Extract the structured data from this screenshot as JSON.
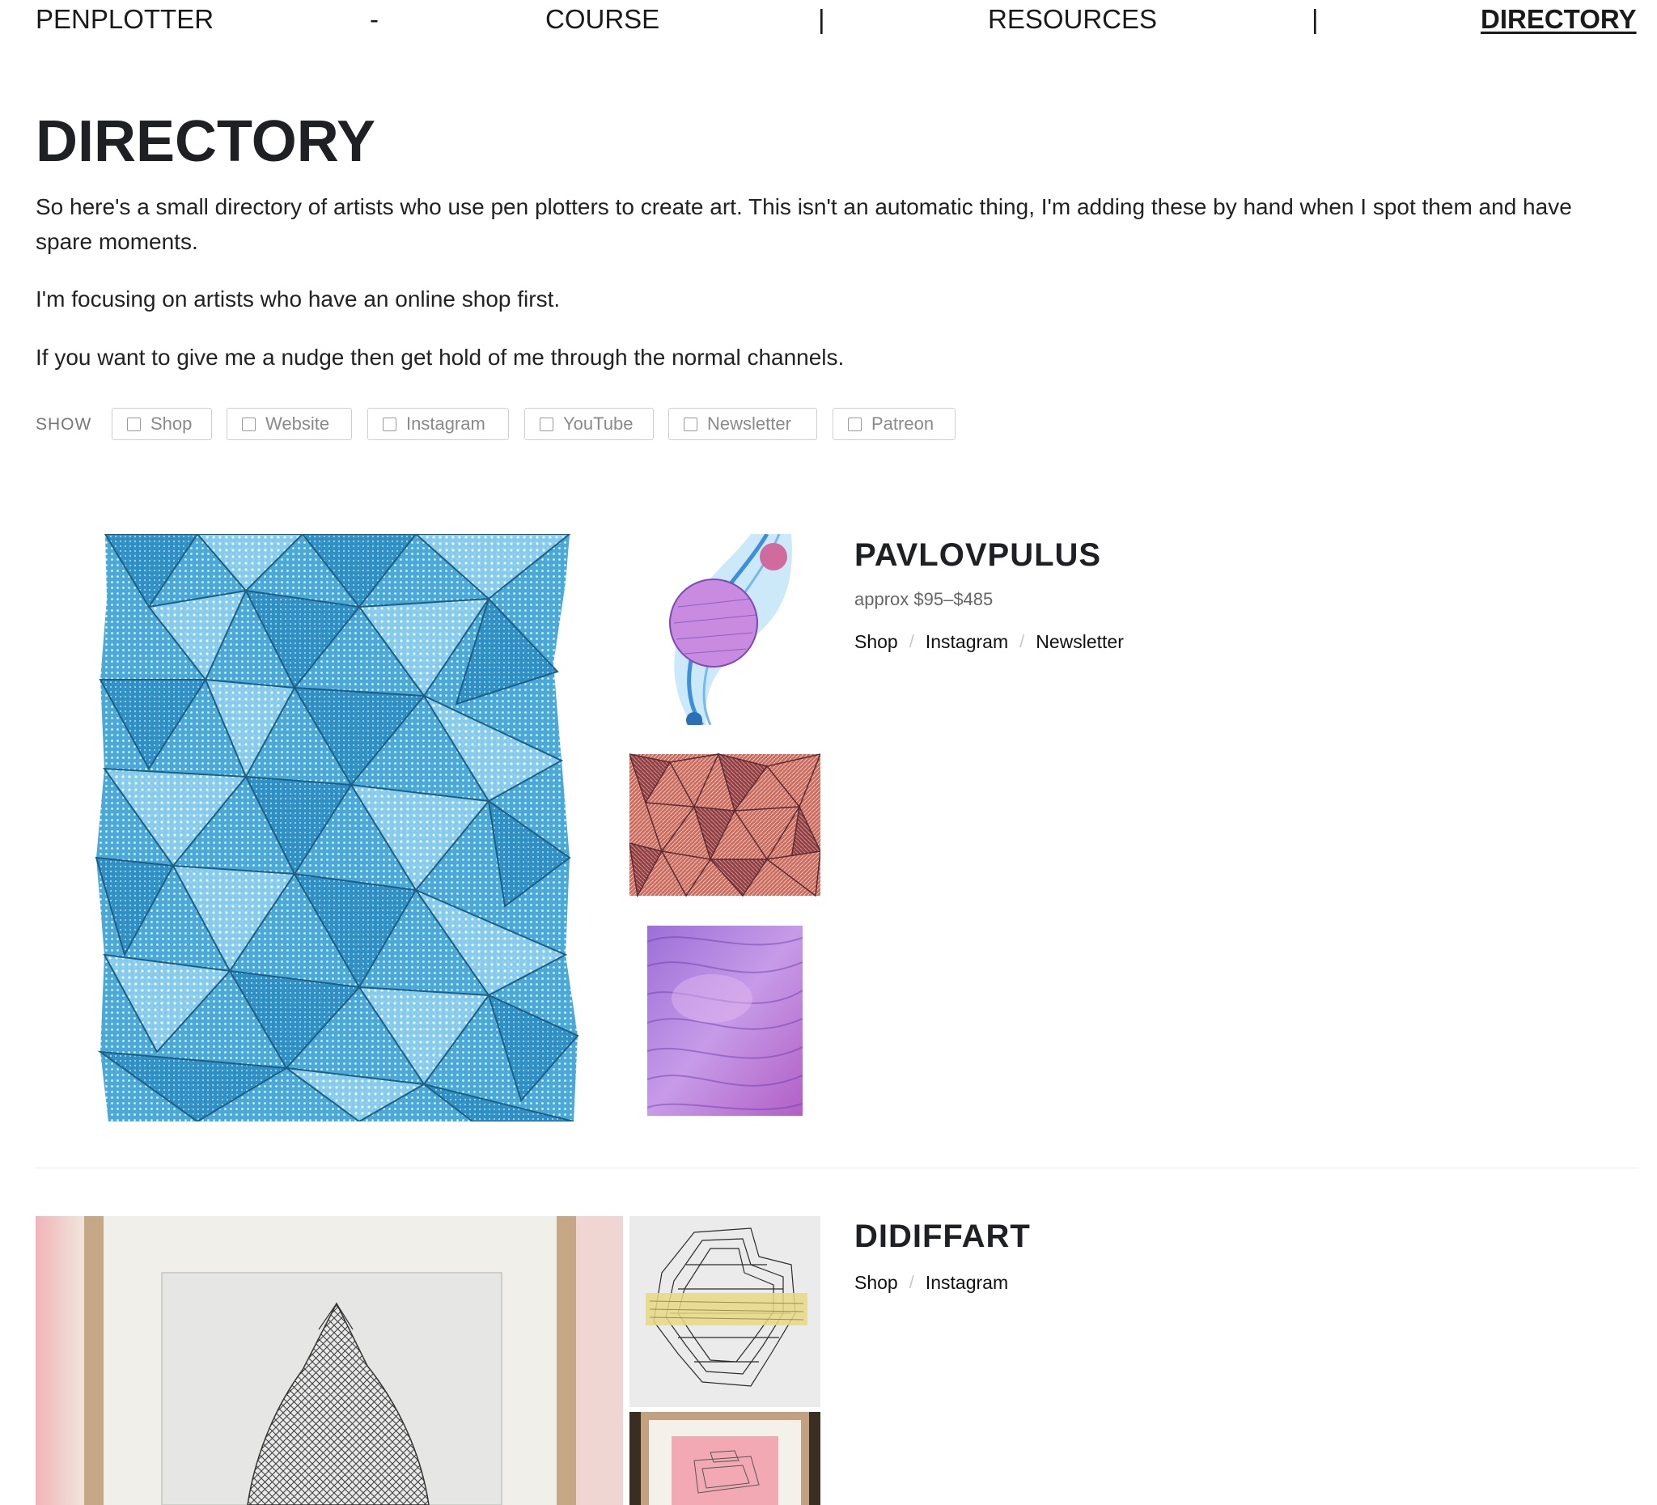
{
  "nav": {
    "items": [
      {
        "label": "PENPLOTTER"
      },
      {
        "label": "COURSE"
      },
      {
        "label": "RESOURCES"
      },
      {
        "label": "DIRECTORY"
      }
    ],
    "separators": [
      "-",
      "|",
      "|"
    ]
  },
  "intro": {
    "title": "DIRECTORY",
    "paragraphs": [
      "So here's a small directory of artists who use pen plotters to create art. This isn't an automatic thing, I'm adding these by hand when I spot them and have spare moments.",
      "I'm focusing on artists who have an online shop first.",
      "If you want to give me a nudge then get hold of me through the normal channels."
    ]
  },
  "filters": {
    "label": "SHOW",
    "options": [
      "Shop",
      "Website",
      "Instagram",
      "YouTube",
      "Newsletter",
      "Patreon"
    ]
  },
  "artists": [
    {
      "name": "PAVLOVPULUS",
      "price": "approx $95–$485",
      "links": [
        "Shop",
        "Instagram",
        "Newsletter"
      ]
    },
    {
      "name": "DIDIFFART",
      "links": [
        "Shop",
        "Instagram"
      ]
    }
  ],
  "colors": {
    "text": "#1f2023",
    "muted": "#777777",
    "border": "#cfcfcf",
    "blue_artwork": "#3fa2d0",
    "red_artwork": "#c25a52",
    "purple_artwork": "#b06fd1"
  }
}
